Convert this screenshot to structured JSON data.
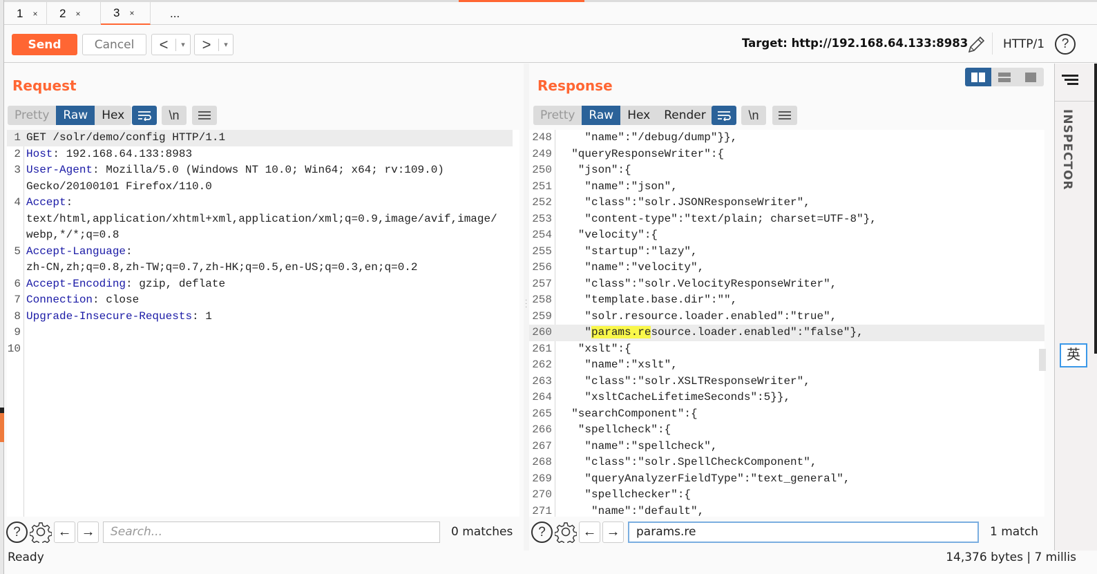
{
  "tabs": [
    {
      "label": "1",
      "close": "×"
    },
    {
      "label": "2",
      "close": "×"
    },
    {
      "label": "3",
      "close": "×",
      "active": true
    },
    {
      "label": "..."
    }
  ],
  "toolbar": {
    "send_label": "Send",
    "cancel_label": "Cancel",
    "back_arrow": "<",
    "forward_arrow": ">",
    "dropdown": "▾",
    "target": "Target: http://192.168.64.133:8983",
    "protocol": "HTTP/1",
    "help": "?"
  },
  "request": {
    "title": "Request",
    "view_tabs": [
      "Pretty",
      "Raw",
      "Hex"
    ],
    "active_view": "Raw",
    "newline_btn": "\\n",
    "lines": [
      {
        "n": "1",
        "name": "",
        "value": "GET /solr/demo/config HTTP/1.1"
      },
      {
        "n": "2",
        "name": "Host",
        "value": ": 192.168.64.133:8983"
      },
      {
        "n": "3",
        "name": "User-Agent",
        "value": ": Mozilla/5.0 (Windows NT 10.0; Win64; x64; rv:109.0)"
      },
      {
        "n": "",
        "name": "",
        "value": "Gecko/20100101 Firefox/110.0"
      },
      {
        "n": "4",
        "name": "Accept",
        "value": ":"
      },
      {
        "n": "",
        "name": "",
        "value": "text/html,application/xhtml+xml,application/xml;q=0.9,image/avif,image/"
      },
      {
        "n": "",
        "name": "",
        "value": "webp,*/*;q=0.8"
      },
      {
        "n": "5",
        "name": "Accept-Language",
        "value": ":"
      },
      {
        "n": "",
        "name": "",
        "value": "zh-CN,zh;q=0.8,zh-TW;q=0.7,zh-HK;q=0.5,en-US;q=0.3,en;q=0.2"
      },
      {
        "n": "6",
        "name": "Accept-Encoding",
        "value": ": gzip, deflate"
      },
      {
        "n": "7",
        "name": "Connection",
        "value": ": close"
      },
      {
        "n": "8",
        "name": "Upgrade-Insecure-Requests",
        "value": ": 1"
      },
      {
        "n": "9",
        "name": "",
        "value": ""
      },
      {
        "n": "10",
        "name": "",
        "value": ""
      }
    ],
    "search": {
      "placeholder": "Search...",
      "value": "",
      "matches": "0 matches"
    }
  },
  "response": {
    "title": "Response",
    "view_tabs": [
      "Pretty",
      "Raw",
      "Hex",
      "Render"
    ],
    "active_view": "Raw",
    "newline_btn": "\\n",
    "lines": [
      {
        "n": "248",
        "text": "    \"name\":\"/debug/dump\"}},"
      },
      {
        "n": "249",
        "text": "  \"queryResponseWriter\":{"
      },
      {
        "n": "250",
        "text": "   \"json\":{"
      },
      {
        "n": "251",
        "text": "    \"name\":\"json\","
      },
      {
        "n": "252",
        "text": "    \"class\":\"solr.JSONResponseWriter\","
      },
      {
        "n": "253",
        "text": "    \"content-type\":\"text/plain; charset=UTF-8\"},"
      },
      {
        "n": "254",
        "text": "   \"velocity\":{"
      },
      {
        "n": "255",
        "text": "    \"startup\":\"lazy\","
      },
      {
        "n": "256",
        "text": "    \"name\":\"velocity\","
      },
      {
        "n": "257",
        "text": "    \"class\":\"solr.VelocityResponseWriter\","
      },
      {
        "n": "258",
        "text": "    \"template.base.dir\":\"\","
      },
      {
        "n": "259",
        "text": "    \"solr.resource.loader.enabled\":\"true\","
      },
      {
        "n": "260",
        "pre": "    \"",
        "match": "params.re",
        "text": "source.loader.enabled\":\"false\"},",
        "highlight": true
      },
      {
        "n": "261",
        "text": "   \"xslt\":{"
      },
      {
        "n": "262",
        "text": "    \"name\":\"xslt\","
      },
      {
        "n": "263",
        "text": "    \"class\":\"solr.XSLTResponseWriter\","
      },
      {
        "n": "264",
        "text": "    \"xsltCacheLifetimeSeconds\":5}},"
      },
      {
        "n": "265",
        "text": "  \"searchComponent\":{"
      },
      {
        "n": "266",
        "text": "   \"spellcheck\":{"
      },
      {
        "n": "267",
        "text": "    \"name\":\"spellcheck\","
      },
      {
        "n": "268",
        "text": "    \"class\":\"solr.SpellCheckComponent\","
      },
      {
        "n": "269",
        "text": "    \"queryAnalyzerFieldType\":\"text_general\","
      },
      {
        "n": "270",
        "text": "    \"spellchecker\":{"
      },
      {
        "n": "271",
        "text": "     \"name\":\"default\","
      }
    ],
    "search": {
      "placeholder": "Search...",
      "value": "params.re",
      "matches": "1 match"
    }
  },
  "inspector": {
    "label": "INSPECTOR"
  },
  "ime": {
    "label": "英"
  },
  "status": {
    "left": "Ready",
    "right": "14,376 bytes | 7 millis"
  },
  "colors": {
    "accent": "#ff6633",
    "active_tab": "#2b6299",
    "header_name": "#1a1aa6",
    "search_highlight": "#f9f74a"
  }
}
